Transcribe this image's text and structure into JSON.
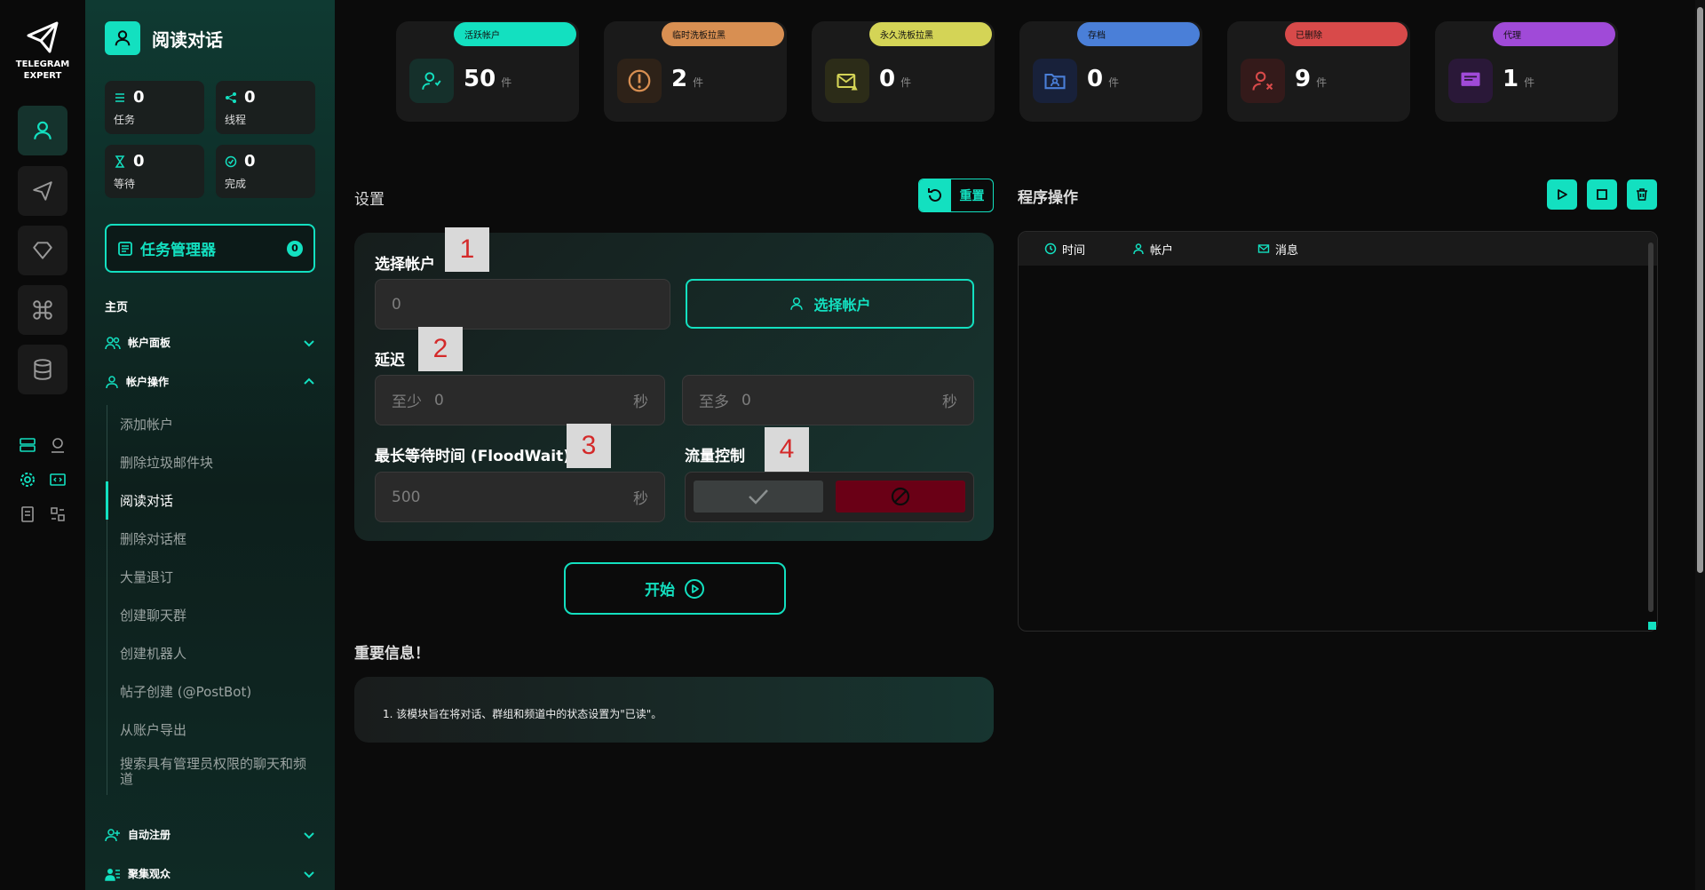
{
  "app": {
    "logo_line1": "TELEGRAM",
    "logo_line2": "EXPERT"
  },
  "sidebar": {
    "title": "阅读对话",
    "stats": [
      {
        "value": "0",
        "label": "任务"
      },
      {
        "value": "0",
        "label": "线程"
      },
      {
        "value": "0",
        "label": "等待"
      },
      {
        "value": "0",
        "label": "完成"
      }
    ],
    "task_manager": {
      "label": "任务管理器",
      "count": "0"
    },
    "section": "主页",
    "groups": {
      "account_panel": "帐户面板",
      "account_ops": "帐户操作",
      "auto_register": "自动注册",
      "gather_audience": "聚集观众"
    },
    "items": [
      "添加帐户",
      "删除垃圾邮件块",
      "阅读对话",
      "删除对话框",
      "大量退订",
      "创建聊天群",
      "创建机器人",
      "帖子创建 (@PostBot)",
      "从账户导出",
      "搜索具有管理员权限的聊天和频道"
    ]
  },
  "cards": [
    {
      "tag": "活跃帐户",
      "value": "50",
      "unit": "件",
      "color": "#13e0c0"
    },
    {
      "tag": "临时洗板拉黑",
      "value": "2",
      "unit": "件",
      "color": "#d88f52"
    },
    {
      "tag": "永久洗板拉黑",
      "value": "0",
      "unit": "件",
      "color": "#d4d456"
    },
    {
      "tag": "存档",
      "value": "0",
      "unit": "件",
      "color": "#4a7fd8"
    },
    {
      "tag": "已删除",
      "value": "9",
      "unit": "件",
      "color": "#d84a4a"
    },
    {
      "tag": "代理",
      "value": "1",
      "unit": "件",
      "color": "#a04ad8"
    }
  ],
  "settings": {
    "title": "设置",
    "reset_label": "重置",
    "select_account_label": "选择帐户",
    "account_value": "0",
    "select_account_button": "选择帐户",
    "delay_label": "延迟",
    "delay_min_prefix": "至少",
    "delay_min_value": "0",
    "delay_max_prefix": "至多",
    "delay_max_value": "0",
    "seconds_unit": "秒",
    "floodwait_label": "最长等待时间 (FloodWait)",
    "floodwait_value": "500",
    "flow_control_label": "流量控制",
    "start_button": "开始"
  },
  "annotations": [
    "1",
    "2",
    "3",
    "4"
  ],
  "important": {
    "title": "重要信息！",
    "text": "1. 该模块旨在将对话、群组和频道中的状态设置为\"已读\"。"
  },
  "operations": {
    "title": "程序操作",
    "columns": [
      "时间",
      "帐户",
      "消息"
    ]
  },
  "colors": {
    "accent": "#13e0c0",
    "danger": "#6a0016"
  }
}
